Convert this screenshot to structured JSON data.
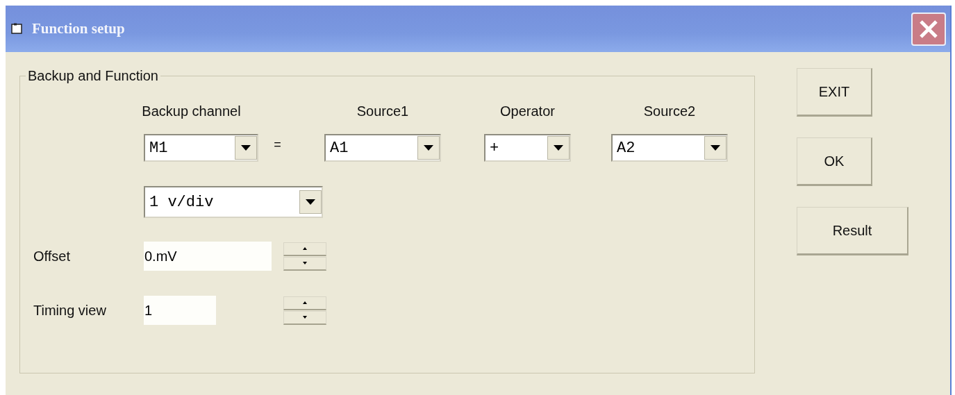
{
  "window": {
    "title": "Function setup"
  },
  "group": {
    "title": "Backup and Function",
    "column_labels": [
      "Backup channel",
      "Source1",
      "Operator",
      "Source2"
    ],
    "equals": "=",
    "combos": [
      {
        "value": "M1"
      },
      {
        "value": "A1"
      },
      {
        "value": "+"
      },
      {
        "value": "A2"
      }
    ],
    "scale": {
      "value": "1 v/div"
    },
    "offset": {
      "label": "Offset",
      "value": "0.mV"
    },
    "timing_view": {
      "label": "Timing view",
      "value": "1"
    }
  },
  "buttons": [
    "EXIT",
    "OK",
    "Result"
  ]
}
